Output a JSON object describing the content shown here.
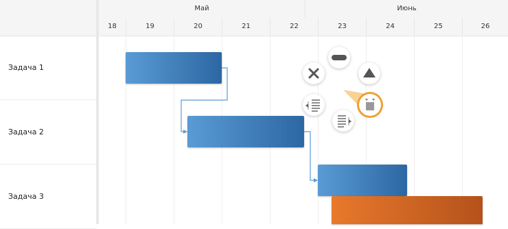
{
  "timeline": {
    "months": [
      {
        "label": "Май"
      },
      {
        "label": "Июнь"
      }
    ],
    "days": [
      "18",
      "19",
      "20",
      "21",
      "22",
      "23",
      "24",
      "25",
      "26"
    ]
  },
  "tasks": [
    {
      "name": "Задача 1"
    },
    {
      "name": "Задача 2"
    },
    {
      "name": "Задача 3"
    }
  ],
  "colors": {
    "bar_blue": "#3d7fc0",
    "bar_orange": "#d2662a",
    "connector": "#5a9bd5",
    "menu_highlight": "#f0a030"
  },
  "radial_menu": {
    "items": [
      {
        "icon": "delete-icon"
      },
      {
        "icon": "minus-icon"
      },
      {
        "icon": "triangle-up-icon"
      },
      {
        "icon": "indent-left-icon"
      },
      {
        "icon": "indent-right-icon"
      },
      {
        "icon": "task-type-icon"
      }
    ]
  }
}
